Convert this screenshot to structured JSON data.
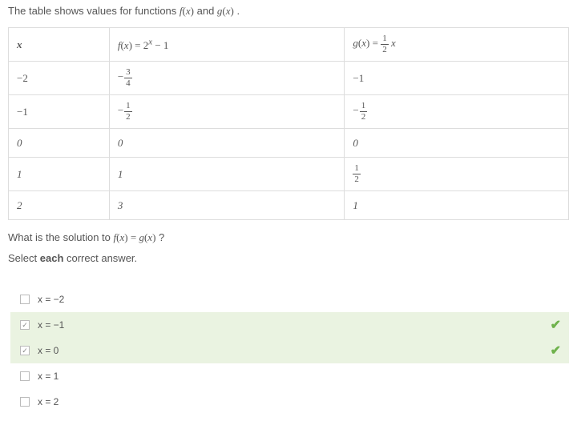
{
  "prompt": {
    "prefix": "The table shows values for functions ",
    "f_label": "f(x)",
    "and": " and ",
    "g_label": "g(x)",
    "suffix": " ."
  },
  "table": {
    "headers": {
      "x": "x",
      "f": "f(x) = 2^x − 1",
      "g": "g(x) = ½ x"
    },
    "rows": [
      {
        "x": "−2",
        "f_type": "frac",
        "f_sign": "−",
        "f_num": "3",
        "f_den": "4",
        "g_type": "plain",
        "g": "−1"
      },
      {
        "x": "−1",
        "f_type": "frac",
        "f_sign": "−",
        "f_num": "1",
        "f_den": "2",
        "g_type": "frac",
        "g_sign": "−",
        "g_num": "1",
        "g_den": "2"
      },
      {
        "x": "0",
        "f_type": "plain",
        "f": "0",
        "g_type": "plain",
        "g": "0"
      },
      {
        "x": "1",
        "f_type": "plain",
        "f": "1",
        "g_type": "frac",
        "g_sign": "",
        "g_num": "1",
        "g_den": "2"
      },
      {
        "x": "2",
        "f_type": "plain",
        "f": "3",
        "g_type": "plain",
        "g": "1"
      }
    ]
  },
  "question": {
    "prefix": "What is the solution to ",
    "equation": "f(x) = g(x)",
    "suffix": " ?"
  },
  "instruction": {
    "prefix": "Select ",
    "bold": "each",
    "suffix": " correct answer."
  },
  "answers": [
    {
      "label": "x = −2",
      "checked": false,
      "correct": false
    },
    {
      "label": "x = −1",
      "checked": true,
      "correct": true
    },
    {
      "label": "x = 0",
      "checked": true,
      "correct": true
    },
    {
      "label": "x = 1",
      "checked": false,
      "correct": false
    },
    {
      "label": "x = 2",
      "checked": false,
      "correct": false
    }
  ],
  "chart_data": {
    "type": "table",
    "title": "Values for f(x)=2^x−1 and g(x)=(1/2)x",
    "columns": [
      "x",
      "f(x)=2^x−1",
      "g(x)=(1/2)x"
    ],
    "rows": [
      [
        -2,
        -0.75,
        -1
      ],
      [
        -1,
        -0.5,
        -0.5
      ],
      [
        0,
        0,
        0
      ],
      [
        1,
        1,
        0.5
      ],
      [
        2,
        3,
        1
      ]
    ],
    "solutions_f_eq_g": [
      -1,
      0
    ]
  }
}
